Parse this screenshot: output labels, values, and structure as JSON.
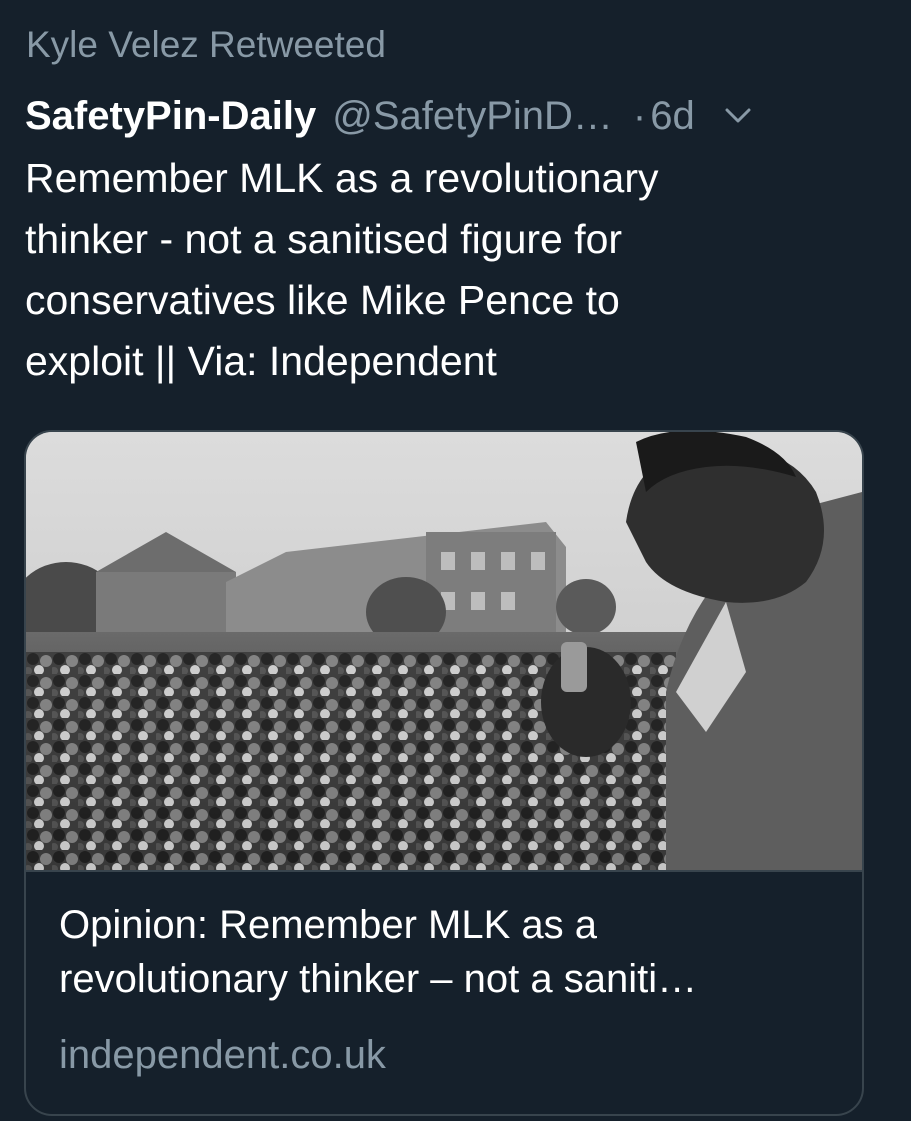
{
  "retweet": {
    "label": "Kyle Velez Retweeted"
  },
  "tweet": {
    "author_name": "SafetyPin-Daily",
    "author_handle": "@SafetyPinD…",
    "separator": "·",
    "timestamp": "6d",
    "menu_icon": "chevron-down-icon",
    "text": "Remember MLK as a revolutionary\nthinker - not a sanitised figure for\nconservatives like Mike Pence to\nexploit || Via: Independent"
  },
  "card": {
    "image_description_icon": "photo",
    "title": "Opinion: Remember MLK as a\nrevolutionary thinker – not a saniti…",
    "domain": "independent.co.uk"
  },
  "colors": {
    "background": "#15202b",
    "primary_text": "#ffffff",
    "secondary_text": "#8899a6",
    "border": "#38444d"
  }
}
